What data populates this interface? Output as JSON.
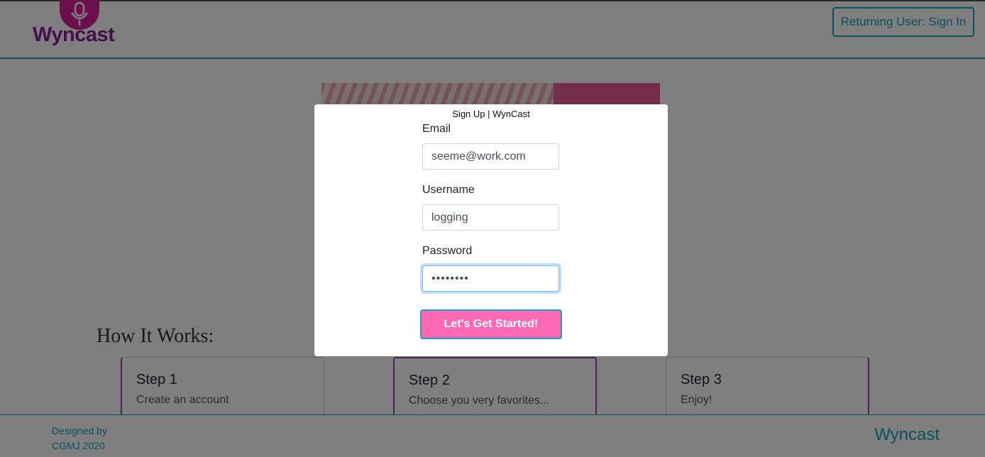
{
  "navbar": {
    "logo_text": "Wyncast",
    "signin_label": "Returning User: Sign In"
  },
  "main": {
    "how_title": "How It Works:",
    "steps": [
      {
        "title": "Step 1",
        "text": "Create an account"
      },
      {
        "title": "Step 2",
        "text": "Choose you very favorites..."
      },
      {
        "title": "Step 3",
        "text": "Enjoy!"
      }
    ]
  },
  "footer": {
    "credit": "Designed by CGMJ 2020",
    "brand": "Wyncast"
  },
  "modal": {
    "title": "Sign Up | WynCast",
    "email_label": "Email",
    "email_value": "seeme@work.com",
    "username_label": "Username",
    "username_value": "logging",
    "password_label": "Password",
    "password_value": "••••••••",
    "submit_label": "Let's Get Started!"
  },
  "colors": {
    "accent": "#17a2b8",
    "brand_pink": "#ff69b4",
    "logo_magenta": "#d6219b",
    "logo_purple": "#8a1f9e"
  },
  "icons": {
    "logo": "microphone-icon"
  }
}
